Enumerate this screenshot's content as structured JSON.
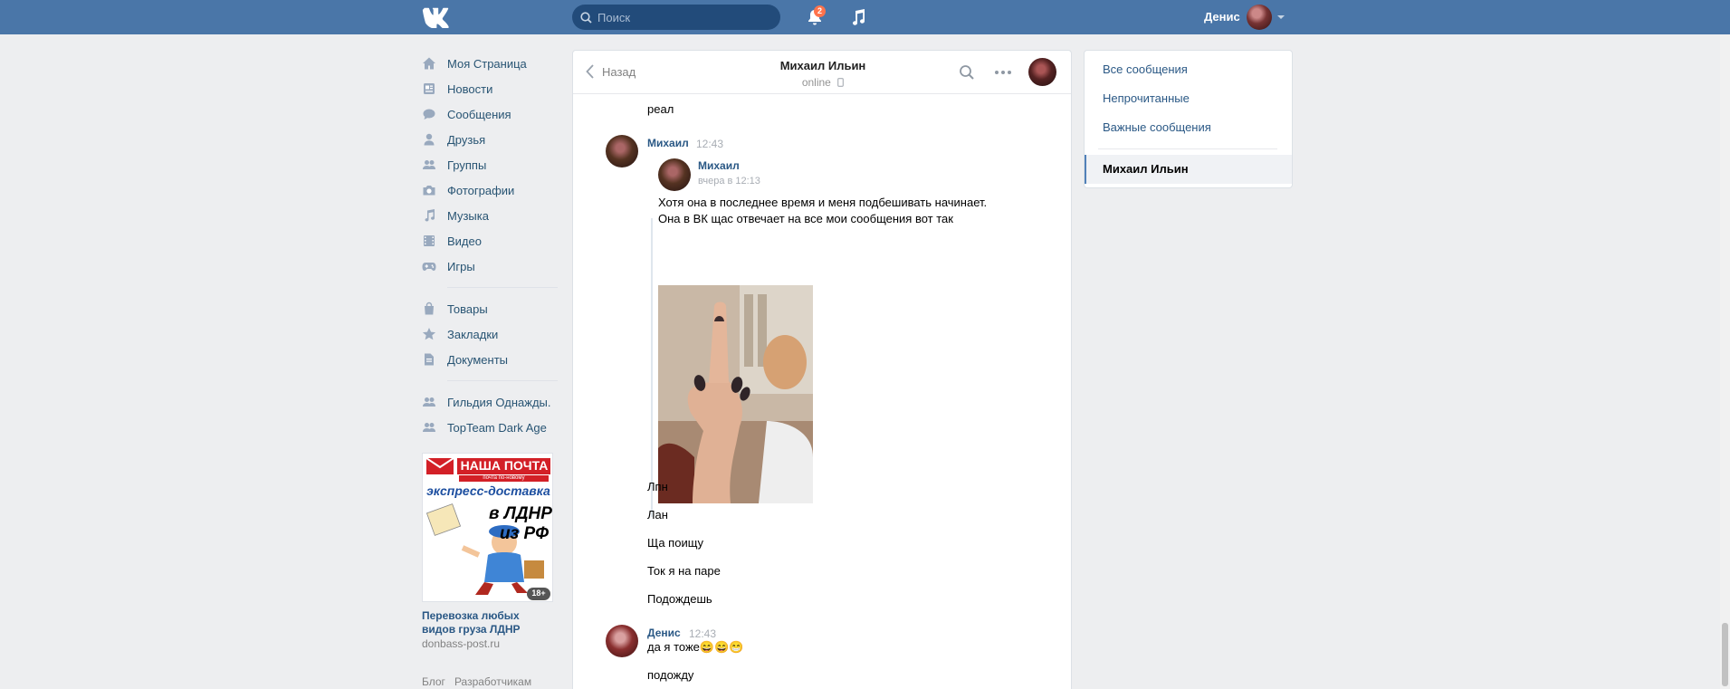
{
  "header": {
    "search_placeholder": "Поиск",
    "notifications_count": "2",
    "user_name": "Денис"
  },
  "sidebar": {
    "items": [
      {
        "label": "Моя Страница",
        "icon": "home-icon"
      },
      {
        "label": "Новости",
        "icon": "news-icon"
      },
      {
        "label": "Сообщения",
        "icon": "messages-icon"
      },
      {
        "label": "Друзья",
        "icon": "friends-icon"
      },
      {
        "label": "Группы",
        "icon": "groups-icon"
      },
      {
        "label": "Фотографии",
        "icon": "camera-icon"
      },
      {
        "label": "Музыка",
        "icon": "music-icon"
      },
      {
        "label": "Видео",
        "icon": "video-icon"
      },
      {
        "label": "Игры",
        "icon": "gamepad-icon"
      }
    ],
    "items2": [
      {
        "label": "Товары",
        "icon": "bag-icon"
      },
      {
        "label": "Закладки",
        "icon": "star-icon"
      },
      {
        "label": "Документы",
        "icon": "document-icon"
      }
    ],
    "groups": [
      {
        "label": "Гильдия Однажды.",
        "icon": "group-icon"
      },
      {
        "label": "TopTeam Dark Age",
        "icon": "group-icon"
      }
    ]
  },
  "ad": {
    "brand": "НАША ПОЧТА",
    "tagline": "почта по-новому",
    "line1": "экспресс-доставка",
    "line2": "в ЛДНР",
    "line3": "из РФ",
    "age": "18+",
    "title": "Перевозка любых видов груза ЛДНР",
    "url": "donbass-post.ru"
  },
  "footer": {
    "blog": "Блог",
    "developers": "Разработчикам"
  },
  "chat": {
    "back_label": "Назад",
    "title": "Михаил Ильин",
    "status": "online",
    "messages": {
      "m0": "реал",
      "author1": "Михаил",
      "time1": "12:43",
      "fwd_author": "Михаил",
      "fwd_time": "вчера в 12:13",
      "fwd_text1": "Хотя она в последнее время и меня подбешивать начинает.",
      "fwd_text2": "Она в ВК щас отвечает на все мои сообщения вот так",
      "m2": "Лпн",
      "m3": "Лан",
      "m4": "Ща поищу",
      "m5": "Ток я на паре",
      "m6": "Подождешь",
      "author2": "Денис",
      "time2": "12:43",
      "m7": "да я тоже😄😄😁",
      "m8": "подожду"
    }
  },
  "right_panel": {
    "all": "Все сообщения",
    "unread": "Непрочитанные",
    "important": "Важные сообщения",
    "active_chat": "Михаил Ильин"
  },
  "colors": {
    "header_bg": "#4a76a8",
    "link": "#2a5885",
    "page_bg": "#edeef0",
    "badge": "#ff734c"
  }
}
